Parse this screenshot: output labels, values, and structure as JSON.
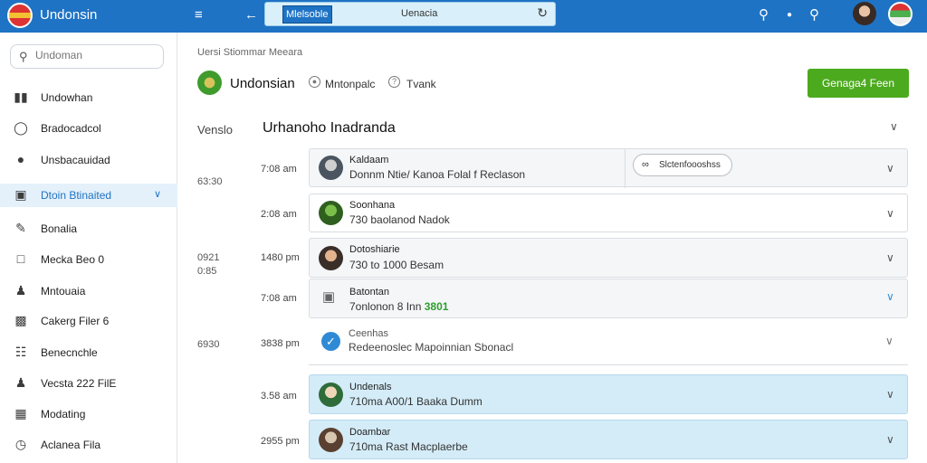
{
  "app": {
    "title": "Undonsin"
  },
  "topbar": {
    "chip": "Mlelsoble",
    "search_value": "Uenacia",
    "icons": [
      "menu-icon",
      "back-icon",
      "refresh-icon",
      "search-icon",
      "dot-icon",
      "search-icon"
    ]
  },
  "sidebar": {
    "search_placeholder": "Undoman",
    "items": [
      {
        "label": "Undowhan",
        "icon": "bar-chart-icon"
      },
      {
        "label": "Bradocadcol",
        "icon": "chat-icon"
      },
      {
        "label": "Unsbacauidad",
        "icon": "tag-icon"
      },
      {
        "label": "Dtoin Btinaited",
        "icon": "camera-icon",
        "active": true
      },
      {
        "label": "Bonalia",
        "icon": "pen-icon"
      },
      {
        "label": "Mecka Beo 0",
        "icon": "file-icon"
      },
      {
        "label": "Mntouaia",
        "icon": "people-icon"
      },
      {
        "label": "Cakerg Filer 6",
        "icon": "edit-file-icon"
      },
      {
        "label": "Benecnchle",
        "icon": "grid-icon"
      },
      {
        "label": "Vecsta 222 FilE",
        "icon": "person-icon"
      },
      {
        "label": "Modating",
        "icon": "image-icon"
      },
      {
        "label": "Aclanea Fila",
        "icon": "clock-icon"
      }
    ]
  },
  "main": {
    "breadcrumb": "Uersi Stiommar Meeara",
    "profile_name": "Undonsian",
    "option1": "Mntonpalc",
    "option2": "Tvank",
    "green_button": "Genaga4 Feen",
    "section_label": "Venslo",
    "section_title": "Urhanoho Inadranda",
    "side_times": [
      "63:30",
      "0921\n0:85",
      "6930"
    ],
    "tag_pill": "Slctenfoooshss",
    "rows": [
      {
        "time": "7:08 am",
        "title": "Kaldaam",
        "sub": "Donnm Ntie/ Kanoa Folal f Reclason",
        "style": "white"
      },
      {
        "time": "2:08 am",
        "title": "Soonhana",
        "sub": "730 baolanod Nadok",
        "style": "white"
      },
      {
        "time": "1480 pm",
        "title": "Dotoshiarie",
        "sub": "730 to 1000 Besam",
        "style": "grey"
      },
      {
        "time": "7:08 am",
        "title": "Batontan",
        "sub": "7onlonon 8 Inn",
        "highlight": "3801",
        "style": "grey"
      },
      {
        "time": "3838 pm",
        "title": "Ceenhas",
        "sub": "Redeenoslec Mapoinnian Sbonacl",
        "style": "white"
      },
      {
        "time": "3.58 am",
        "title": "Undenals",
        "sub": "710ma A00/1 Baaka Dumm",
        "style": "blue"
      },
      {
        "time": "2955 pm",
        "title": "Doambar",
        "sub": "710ma Rast Macplaerbe",
        "style": "blue"
      }
    ]
  }
}
